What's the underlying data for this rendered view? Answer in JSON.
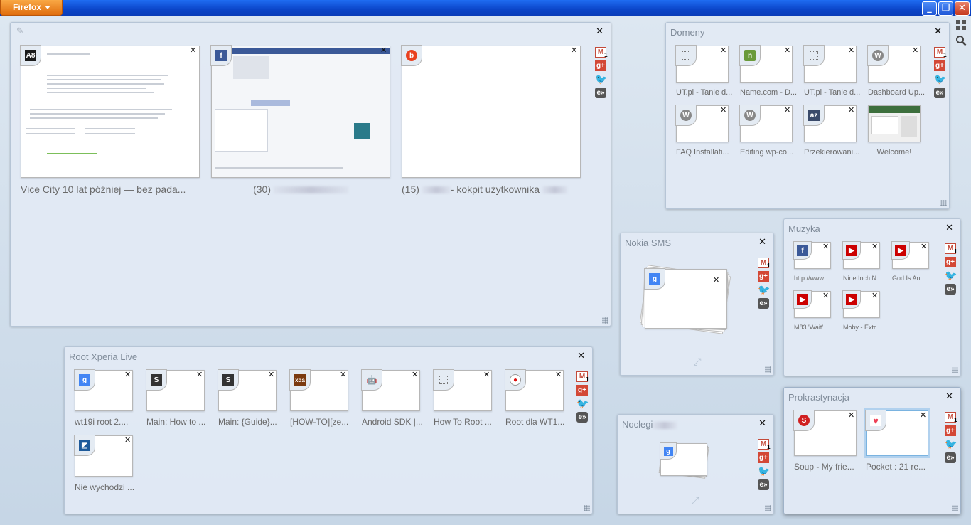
{
  "window": {
    "button_label": "Firefox",
    "minimize": "_",
    "restore": "❐",
    "close": "✕"
  },
  "tools": {
    "groups_icon": "groups-view-icon",
    "search_icon": "search-icon"
  },
  "close_char": "✕",
  "share": {
    "gmail": "M",
    "gmail_badge": "1",
    "gplus": "g+",
    "twitter": "🐦",
    "ex": "e»"
  },
  "groups": [
    {
      "title": "",
      "tabs": [
        {
          "title": "Vice City 10 lat później — bez pada...",
          "favicon": "A8",
          "favicon_color": "#1a1a1a"
        },
        {
          "title": "(30)",
          "favicon": "f",
          "favicon_color": "#3b5998",
          "blurred": true
        },
        {
          "title": "(15)",
          "title_suffix": "- kokpit użytkownika",
          "favicon": "b",
          "favicon_color": "#e9401e",
          "blurred": true
        }
      ]
    },
    {
      "title": "Domeny",
      "tabs": [
        {
          "title": "UT.pl - Tanie d...",
          "favicon": "blank-favicon"
        },
        {
          "title": "Name.com - D...",
          "favicon": "n",
          "favicon_color": "#6a9a3a"
        },
        {
          "title": "UT.pl - Tanie d...",
          "favicon": "blank-favicon"
        },
        {
          "title": "Dashboard Up...",
          "favicon": "W",
          "favicon_color": "#888"
        },
        {
          "title": "FAQ Installati...",
          "favicon": "W",
          "favicon_color": "#888"
        },
        {
          "title": "Editing wp-co...",
          "favicon": "W",
          "favicon_color": "#888"
        },
        {
          "title": "Przekierowani...",
          "favicon": "az",
          "favicon_color": "#3a4a6a"
        },
        {
          "title": "Welcome!",
          "favicon": "thumbnail"
        }
      ]
    },
    {
      "title": "Nokia SMS",
      "tabs": [
        {
          "title": "",
          "favicon": "g",
          "favicon_color": "#4285f4"
        }
      ]
    },
    {
      "title": "Muzyka",
      "tabs": [
        {
          "title": "http://www....",
          "favicon": "f",
          "favicon_color": "#3b5998"
        },
        {
          "title": "Nine Inch N...",
          "favicon": "▶",
          "favicon_color": "#cc0000"
        },
        {
          "title": "God Is An ...",
          "favicon": "▶",
          "favicon_color": "#cc0000"
        },
        {
          "title": "M83 'Wait' ...",
          "favicon": "▶",
          "favicon_color": "#cc0000"
        },
        {
          "title": "Moby - Extr...",
          "favicon": "▶",
          "favicon_color": "#cc0000"
        }
      ]
    },
    {
      "title": "Root Xperia Live",
      "tabs": [
        {
          "title": "wt19i root 2....",
          "favicon": "g",
          "favicon_color": "#4285f4"
        },
        {
          "title": "Main: How to ...",
          "favicon": "S",
          "favicon_color": "#333"
        },
        {
          "title": "Main: {Guide}...",
          "favicon": "S",
          "favicon_color": "#333"
        },
        {
          "title": "[HOW-TO][ze...",
          "favicon": "xda",
          "favicon_color": "#7a3a10"
        },
        {
          "title": "Android SDK |...",
          "favicon": "🤖",
          "favicon_color": "#a4c639"
        },
        {
          "title": "How To Root ...",
          "favicon": "blank-favicon"
        },
        {
          "title": "Root dla WT1...",
          "favicon": "●",
          "favicon_color": "#d11"
        },
        {
          "title": "Nie wychodzi ...",
          "favicon": "◩",
          "favicon_color": "#1e5a9a"
        }
      ]
    },
    {
      "title": "Noclegi",
      "tabs": [
        {
          "title": "",
          "favicon": "g",
          "favicon_color": "#4285f4"
        }
      ]
    },
    {
      "title": "Prokrastynacja",
      "tabs": [
        {
          "title": "Soup - My frie...",
          "favicon": "S",
          "favicon_color": "#d02020"
        },
        {
          "title": "Pocket : 21 re...",
          "favicon": "♥",
          "favicon_color": "#ee4056"
        }
      ]
    }
  ]
}
